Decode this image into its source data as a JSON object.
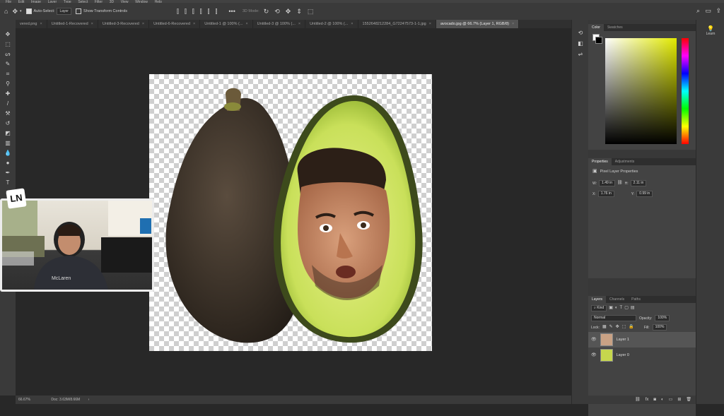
{
  "menubar": {
    "items": [
      "File",
      "Edit",
      "Image",
      "Layer",
      "Type",
      "Select",
      "Filter",
      "3D",
      "View",
      "Window",
      "Help"
    ]
  },
  "options_bar": {
    "auto_select_label": "Auto-Select:",
    "auto_select_target": "Layer",
    "show_transform_label": "Show Transform Controls",
    "mode_3d_label": "3D Mode:"
  },
  "tabs": [
    {
      "label": "vered.png"
    },
    {
      "label": "Untitled-1-Recovered"
    },
    {
      "label": "Untitled-3-Recovered"
    },
    {
      "label": "Untitled-6-Recovered"
    },
    {
      "label": "Untitled-1 @ 100% (..."
    },
    {
      "label": "Untitled-3 @ 100% (..."
    },
    {
      "label": "Untitled-2 @ 100% (..."
    },
    {
      "label": "1552648212284_G72247573-1-1.jpg"
    },
    {
      "label": "avocado.jpg @ 66.7% (Layer 1, RGB/8)",
      "active": true
    }
  ],
  "status": {
    "zoom": "66.67%",
    "doc": "Doc: 3.63M/8.66M"
  },
  "color_panel": {
    "tabs": [
      "Color",
      "Swatches"
    ]
  },
  "properties_panel": {
    "tabs": [
      "Properties",
      "Adjustments"
    ],
    "subtitle": "Pixel Layer Properties",
    "w_label": "W:",
    "w_value": "1.49 in",
    "h_label": "H:",
    "h_value": "2.11 in",
    "x_label": "X:",
    "x_value": "1.76 in",
    "y_label": "Y:",
    "y_value": "0.99 in"
  },
  "layers_panel": {
    "tabs": [
      "Layers",
      "Channels",
      "Paths"
    ],
    "kind_label": "Kind",
    "blend_mode": "Normal",
    "opacity_label": "Opacity:",
    "opacity_value": "100%",
    "lock_label": "Lock:",
    "fill_label": "Fill:",
    "fill_value": "100%",
    "layers": [
      {
        "name": "Layer 1",
        "selected": true
      },
      {
        "name": "Layer 0",
        "selected": false
      }
    ]
  },
  "learn_panel": {
    "label": "Learn"
  },
  "webcam": {
    "logo": "LN"
  },
  "colors": {
    "accent_active_tab": "#535353",
    "avocado_flesh": "#c8df5a",
    "avocado_skin": "#3c342c"
  }
}
